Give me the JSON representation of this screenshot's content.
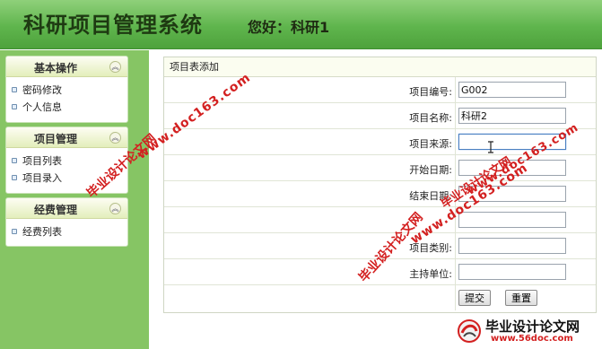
{
  "header": {
    "title": "科研项目管理系统",
    "greeting": "您好：科研1"
  },
  "sidebar": {
    "sections": [
      {
        "title": "基本操作",
        "collapse_icon": "chevron-up-double-icon",
        "items": [
          "密码修改",
          "个人信息"
        ]
      },
      {
        "title": "项目管理",
        "collapse_icon": "chevron-up-double-icon",
        "items": [
          "项目列表",
          "项目录入"
        ]
      },
      {
        "title": "经费管理",
        "collapse_icon": "chevron-up-double-icon",
        "items": [
          "经费列表"
        ]
      }
    ]
  },
  "main": {
    "panel_title": "项目表添加",
    "fields": [
      {
        "label": "项目编号:",
        "value": "G002"
      },
      {
        "label": "项目名称:",
        "value": "科研2"
      },
      {
        "label": "项目来源:",
        "value": ""
      },
      {
        "label": "开始日期:",
        "value": ""
      },
      {
        "label": "结束日期:",
        "value": ""
      },
      {
        "label": "",
        "value": ""
      },
      {
        "label": "项目类别:",
        "value": ""
      },
      {
        "label": "主持单位:",
        "value": ""
      }
    ],
    "submit_label": "提交",
    "reset_label": "重置"
  },
  "watermarks": {
    "text1": "毕业设计论文网",
    "url1": "www.doc163.com",
    "text2": "毕业设计论文网",
    "url2": "www.doc163.com",
    "text3": "毕业设计论文网",
    "url3": "www.doc163.com",
    "logo_text": "毕业设计论文网",
    "logo_url": "www.56doc.com"
  },
  "colors": {
    "header_green": "#5fb54d",
    "sidebar_green": "#86c564",
    "watermark_red": "#d32020"
  }
}
